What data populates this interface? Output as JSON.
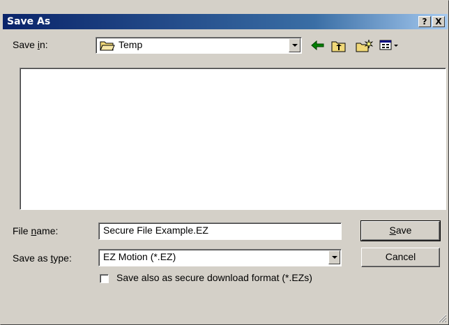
{
  "window": {
    "title": "Save As"
  },
  "titlebar_buttons": {
    "help": "?",
    "close": "X"
  },
  "save_in": {
    "label_pre": "Save ",
    "label_key": "i",
    "label_post": "n:",
    "value": "Temp"
  },
  "toolbar": {
    "icons": [
      "back-arrow-icon",
      "up-folder-icon",
      "new-folder-icon",
      "view-menu-icon"
    ]
  },
  "file_name": {
    "label_pre": "File ",
    "label_key": "n",
    "label_post": "ame:",
    "value": "Secure File Example.EZ"
  },
  "save_as_type": {
    "label_pre": "Save as ",
    "label_key": "t",
    "label_post": "ype:",
    "value": "EZ Motion (*.EZ)"
  },
  "buttons": {
    "save_key": "S",
    "save_rest": "ave",
    "cancel": "Cancel"
  },
  "checkbox": {
    "label": "Save also as secure download format (*.EZs)",
    "checked": false
  },
  "colors": {
    "title_bar": "#0a246a",
    "face": "#d4d0c8",
    "folder": "#f0d878",
    "arrow": "#008000"
  }
}
